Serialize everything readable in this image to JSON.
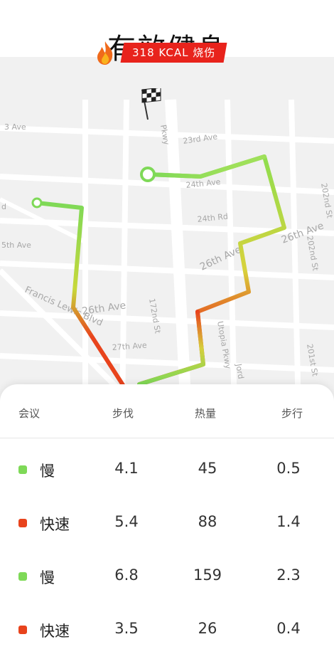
{
  "header": {
    "title": "有效健身"
  },
  "map": {
    "badge_text": "318 KCAL 烧伤",
    "streets": [
      "3 Ave",
      "23rd Ave",
      "Pkwy",
      "24th Ave",
      "202nd St",
      "d",
      "24th Rd",
      "26th Ave",
      "202nd St",
      "5th Ave",
      "26th Ave",
      "Francis Lewis Blvd",
      "26th Ave",
      "172nd St",
      "27th Ave",
      "Utopia Pkwy",
      "Jord",
      "201st St"
    ]
  },
  "table": {
    "headers": [
      "会议",
      "步伐",
      "热量",
      "步行"
    ],
    "rows": [
      {
        "name": "慢",
        "pace": "4.1",
        "cal": "45",
        "walk": "0.5",
        "color": "#7ed957"
      },
      {
        "name": "快速",
        "pace": "5.4",
        "cal": "88",
        "walk": "1.4",
        "color": "#e8431c"
      },
      {
        "name": "慢",
        "pace": "6.8",
        "cal": "159",
        "walk": "2.3",
        "color": "#7ed957"
      },
      {
        "name": "快速",
        "pace": "3.5",
        "cal": "26",
        "walk": "0.4",
        "color": "#e8431c"
      }
    ]
  },
  "colors": {
    "slow": "#7ed957",
    "fast": "#e8431c",
    "badge": "#e8231c"
  }
}
